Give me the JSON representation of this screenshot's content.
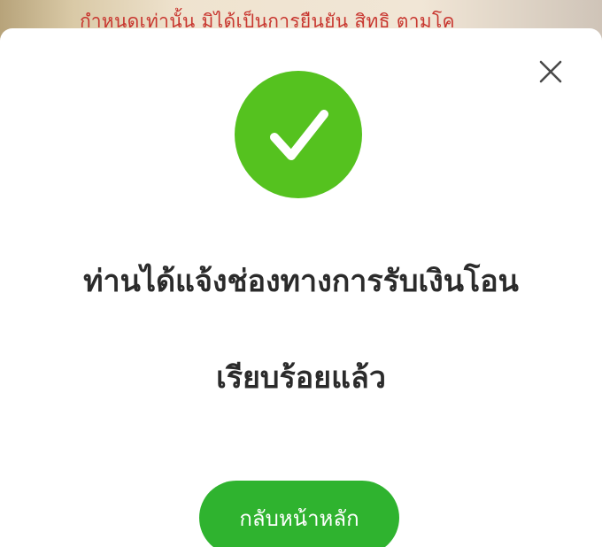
{
  "background": {
    "banner_text": "กำหนดเท่านั้น มิได้เป็นการยืนยัน สิทธิ ตามโค"
  },
  "modal": {
    "close_icon": "close-icon",
    "status_icon": "checkmark-icon",
    "message_line1": "ท่านได้แจ้งช่องทางการรับเงินโอน",
    "message_line2": "เรียบร้อยแล้ว",
    "home_button_label": "กลับหน้าหลัก"
  },
  "colors": {
    "success_green": "#55c21f",
    "button_green": "#2fb32f",
    "banner_text_red": "#c8362f",
    "message_text": "#2b2b2b"
  }
}
